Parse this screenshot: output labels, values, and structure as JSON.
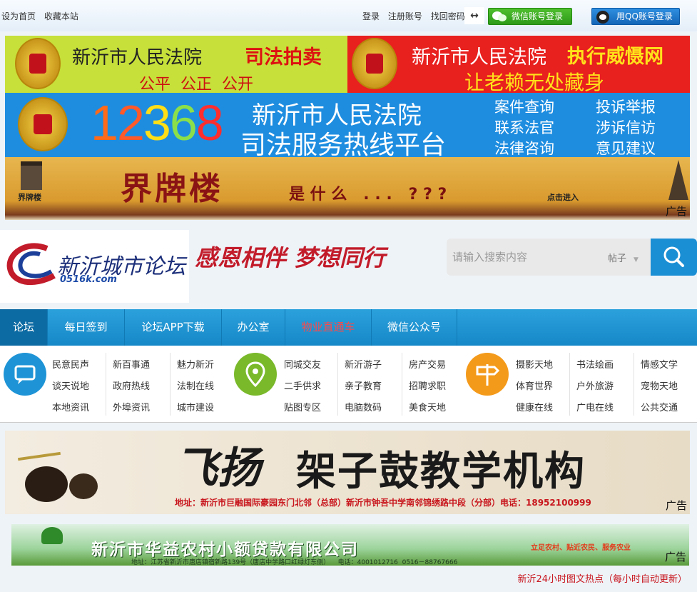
{
  "topbar": {
    "left_links": [
      "设为首页",
      "收藏本站"
    ],
    "right_links": [
      "登录",
      "注册账号",
      "找回密码"
    ],
    "arrows": "↔",
    "wechat_login": "微信账号登录",
    "qq_login": "用QQ账号登录"
  },
  "banners": {
    "auction": {
      "court": "新沂市人民法院",
      "title": "司法拍卖",
      "motto": "公平  公正  公开"
    },
    "enforce": {
      "court": "新沂市人民法院",
      "title": "执行威慑网",
      "slogan": "让老赖无处藏身"
    },
    "hotline": {
      "digits": [
        "1",
        "2",
        "3",
        "6",
        "8"
      ],
      "court": "新沂市人民法院",
      "platform": "司法服务热线平台",
      "links": [
        "案件查询",
        "投诉举报",
        "联系法官",
        "涉诉信访",
        "法律咨询",
        "意见建议"
      ]
    },
    "jiepai": {
      "small": "界牌楼",
      "title": "界牌楼",
      "question": "是 什 么   . . .   ? ? ?",
      "click": "点击进入",
      "ad": "广告"
    },
    "drums": {
      "brand": "飞扬",
      "title": "架子鼓教学机构",
      "address": "地址：新沂市巨融国际豪园东门北邻（总部）新沂市钟吾中学南邻锦绣路中段（分部）电话：18952100999",
      "ad": "广告"
    },
    "loan": {
      "title": "新沂市华益农村小额贷款有限公司",
      "motto": "立足农村、贴近农民、服务农业",
      "address": "地址：江苏省新沂市唐店镇宿新路139号（唐店中学路口红绿灯东侧）    电话：4001012716  0516－88767666",
      "ad": "广告"
    }
  },
  "logo": {
    "text": "新沂城市论坛",
    "sub": "0516k.com",
    "slogan": "感恩相伴 梦想同行"
  },
  "search": {
    "placeholder": "请输入搜索内容",
    "type": "帖子"
  },
  "nav": [
    "论坛",
    "每日签到",
    "论坛APP下载",
    "办公室",
    "物业直通车",
    "微信公众号"
  ],
  "categories": {
    "group1": [
      "民意民声",
      "新百事通",
      "魅力新沂",
      "谈天说地",
      "政府热线",
      "法制在线",
      "本地资讯",
      "外埠资讯",
      "城市建设"
    ],
    "group2": [
      "同城交友",
      "新沂游子",
      "房产交易",
      "二手供求",
      "亲子教育",
      "招聘求职",
      "贴图专区",
      "电脑数码",
      "美食天地"
    ],
    "group3": [
      "摄影天地",
      "书法绘画",
      "情感文学",
      "体育世界",
      "户外旅游",
      "宠物天地",
      "健康在线",
      "广电在线",
      "公共交通"
    ]
  },
  "hot_notice": "新沂24小时图文热点（每小时自动更新）",
  "colors": {
    "nav_blue": "#1b8fd4",
    "court_red": "#c1121b",
    "lime": "#c7e03a",
    "hotline_blue": "#1e8de0"
  }
}
